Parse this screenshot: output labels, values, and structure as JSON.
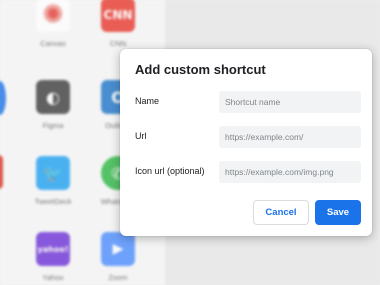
{
  "background_apps": [
    {
      "label": "Canvas",
      "color": "#e23d33",
      "icon": "canvas-icon",
      "glyph": "✺"
    },
    {
      "label": "CNN",
      "color": "#e8352a",
      "icon": "cnn-icon",
      "glyph": "CNN"
    },
    {
      "label": "Figma",
      "color": "#3a3a3a",
      "icon": "figma-icon",
      "glyph": "◐"
    },
    {
      "label": "Outlook",
      "color": "#1c74c8",
      "icon": "outlook-icon",
      "glyph": "O"
    },
    {
      "label": "TweetDeck",
      "color": "#1da1f2",
      "icon": "tweetdeck-icon",
      "glyph": "🐦"
    },
    {
      "label": "WhatsApp",
      "color": "#2bb742",
      "icon": "whatsapp-icon",
      "glyph": "✆"
    },
    {
      "label": "Yahoo",
      "color": "#6b2fd6",
      "icon": "yahoo-icon",
      "glyph": "yahoo!"
    },
    {
      "label": "Zoom",
      "color": "#4a8cff",
      "icon": "zoom-icon",
      "glyph": "▶"
    }
  ],
  "dialog": {
    "title": "Add custom shortcut",
    "name": {
      "label": "Name",
      "placeholder": "Shortcut name",
      "value": ""
    },
    "url": {
      "label": "Url",
      "placeholder": "https://example.com/",
      "value": ""
    },
    "icon_url": {
      "label": "Icon url (optional)",
      "placeholder": "https://example.com/img.png",
      "value": ""
    },
    "cancel_label": "Cancel",
    "save_label": "Save"
  },
  "colors": {
    "accent": "#1a73e8",
    "field_bg": "#f1f3f4",
    "title_text": "#202124"
  }
}
